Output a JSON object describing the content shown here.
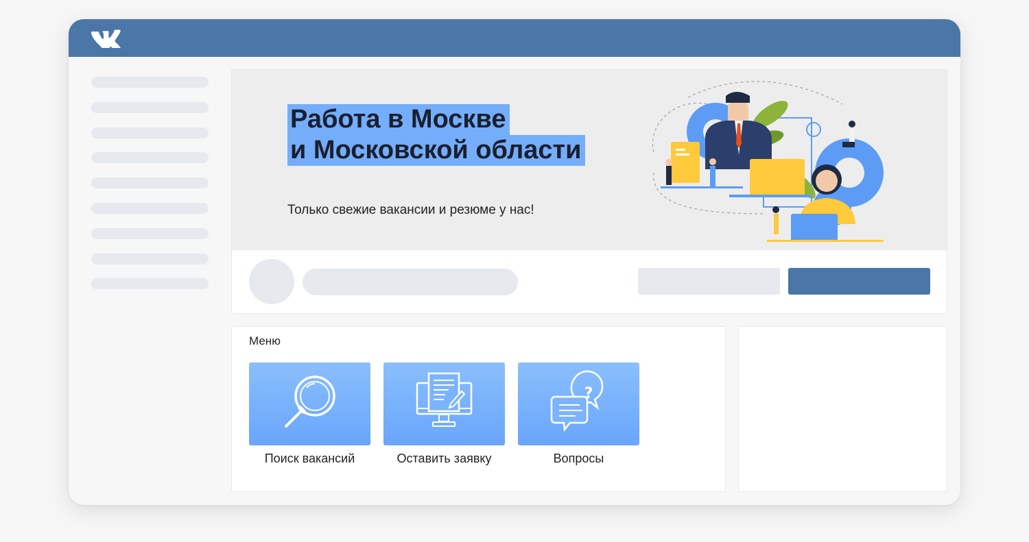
{
  "header": {
    "logo": "VK"
  },
  "cover": {
    "title_line1": "Работа в Москве",
    "title_line2": "и Московской области",
    "subtitle": "Только свежие вакансии и резюме у нас!",
    "illustration": "office-workers-illustration"
  },
  "menu": {
    "title": "Меню",
    "items": [
      {
        "label": "Поиск вакансий",
        "icon": "magnifier-icon"
      },
      {
        "label": "Оставить заявку",
        "icon": "computer-document-icon"
      },
      {
        "label": "Вопросы",
        "icon": "chat-question-icon"
      }
    ]
  },
  "colors": {
    "brand": "#4a76a8",
    "title_highlight": "#74adfa",
    "tile_gradient_top": "#8bbffc",
    "tile_gradient_bottom": "#6aa5fb",
    "placeholder": "#e6e9ee"
  }
}
